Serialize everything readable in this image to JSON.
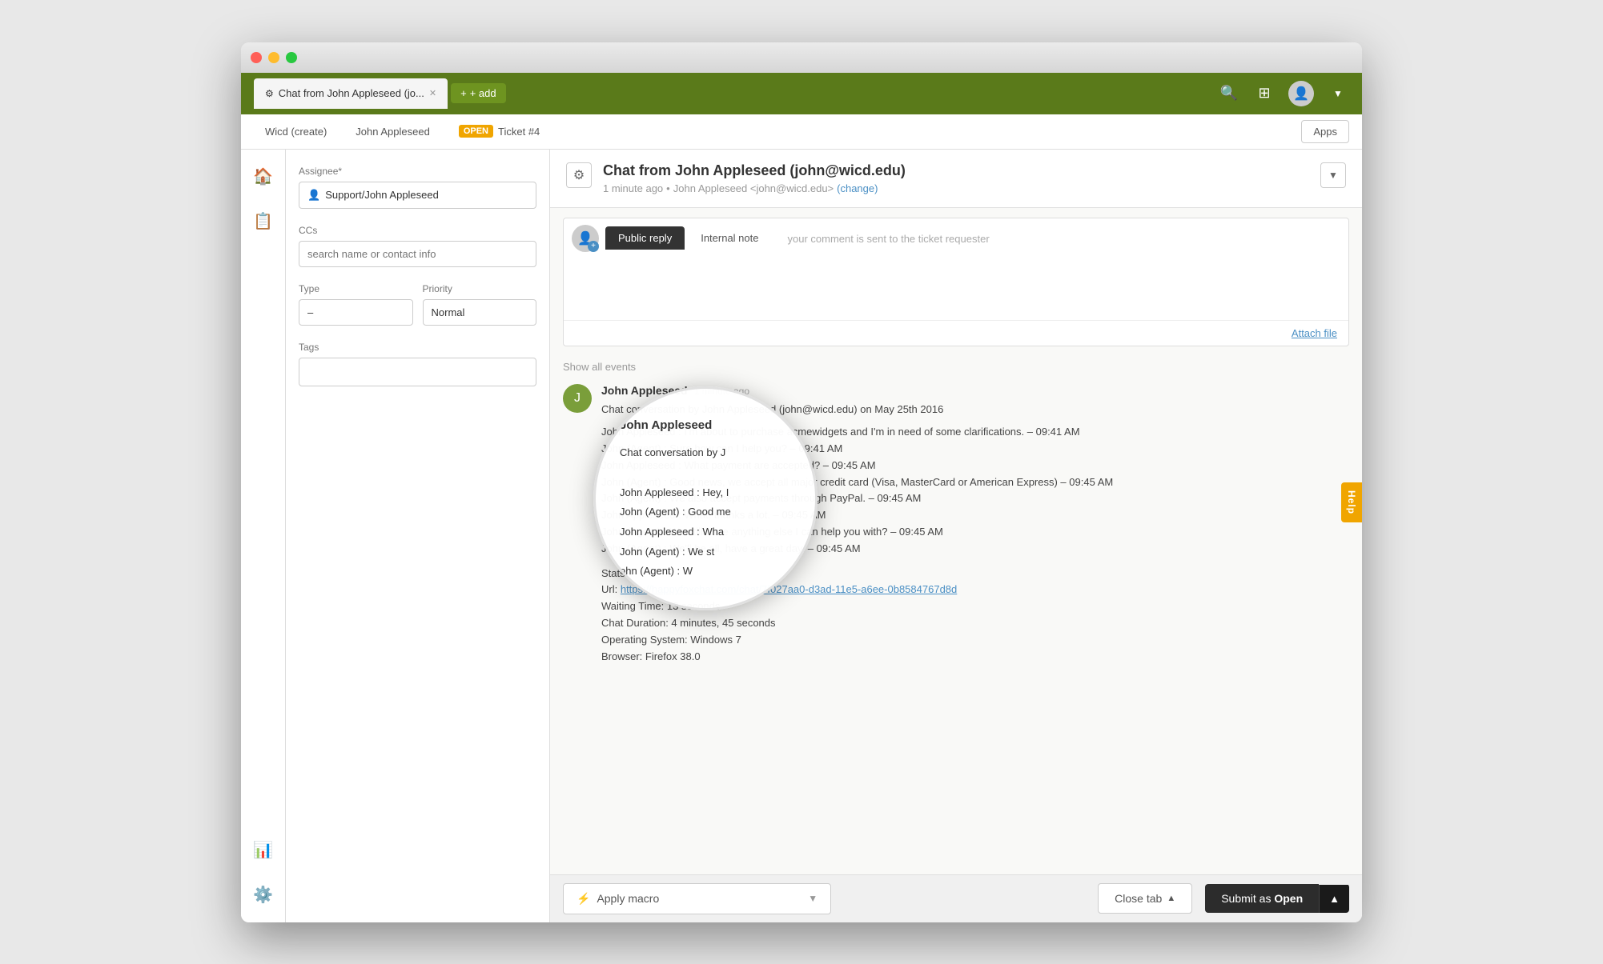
{
  "window": {
    "title": "Chat from John Appleseed (jo..."
  },
  "titlebar": {
    "traffic": {
      "close": "close",
      "minimize": "minimize",
      "maximize": "maximize"
    }
  },
  "topnav": {
    "active_tab": "Chat from John Appleseed (jo...",
    "add_label": "+ add",
    "icons": {
      "search": "🔍",
      "grid": "⊞",
      "avatar": "👤"
    }
  },
  "secondary_nav": {
    "tabs": [
      {
        "label": "Wicd (create)",
        "id": "wicd"
      },
      {
        "label": "John Appleseed",
        "id": "john"
      },
      {
        "label": "OPEN",
        "id": "open_badge"
      },
      {
        "label": "Ticket #4",
        "id": "ticket4"
      }
    ],
    "apps_button": "Apps"
  },
  "left_panel": {
    "assignee_label": "Assignee*",
    "assignee_value": "Support/John Appleseed",
    "ccs_label": "CCs",
    "ccs_placeholder": "search name or contact info",
    "type_label": "Type",
    "type_value": "–",
    "priority_label": "Priority",
    "priority_value": "Normal",
    "tags_label": "Tags",
    "tags_placeholder": ""
  },
  "ticket_header": {
    "title": "Chat from John Appleseed (john@wicd.edu)",
    "time": "1 minute ago",
    "from": "John Appleseed <john@wicd.edu>",
    "change_link": "(change)"
  },
  "reply_area": {
    "tabs": [
      {
        "label": "Public reply",
        "id": "public",
        "active": true
      },
      {
        "label": "Internal note",
        "id": "internal",
        "active": false
      }
    ],
    "hint": "your comment is sent to the ticket requester",
    "placeholder": "",
    "attach_file": "Attach file"
  },
  "thread": {
    "show_all": "Show all events",
    "messages": [
      {
        "author": "John Appleseed",
        "time": "1 minute ago",
        "intro": "Chat conversation by John Appleseed (john@wicd.edu) on May 25th 2016",
        "lines": [
          "John Appleseed : I'm about to purchase acmewidgets and I&#39;m in need of some clarifications. – 09:41 AM",
          "John (Agent) : Sure how can I help you? – 09:41 AM",
          "John Appleseed : What payment are accepted? – 09:45 AM",
          "John (Agent) : Good news, we accept all major credit card (Visa, MasterCard or American Express) – 09:45 AM",
          "John (Agent) : We also accept payments through PayPal. – 09:45 AM",
          "John Appleseed : What, thanks a lot. – 09:45 AM",
          "John (Agent) : We still have anything else I can help you with? – 09:45 AM",
          "John (Agent) : We'll be all, have a great day. – 09:45 AM"
        ],
        "stats": {
          "label": "Stats:",
          "url_label": "Url:",
          "url": "https://happyfoxchat.com/chat/7f027aa0-d3ad-11e5-a6ee-0b8584767d8d",
          "waiting": "Waiting Time: 13 seconds",
          "duration": "Chat Duration: 4 minutes, 45 seconds",
          "os": "Operating System: Windows 7",
          "browser": "Browser: Firefox 38.0"
        }
      }
    ]
  },
  "magnifier": {
    "title": "John Appleseed",
    "lines": [
      "Chat conversation by J",
      "",
      "John Appleseed : Hey, I",
      "John (Agent) : Good me",
      "John Appleseed : Wha",
      "John (Agent) : We st",
      "ohn (Agent) : W"
    ]
  },
  "bottom_bar": {
    "apply_macro": "Apply macro",
    "close_tab": "Close tab",
    "submit_label": "Submit as ",
    "submit_status": "Open"
  },
  "help_btn": "Help",
  "colors": {
    "nav_green": "#5a7a1a",
    "link_blue": "#4a8fc4",
    "open_orange": "#f0a500",
    "dark_btn": "#2c2c2c"
  }
}
